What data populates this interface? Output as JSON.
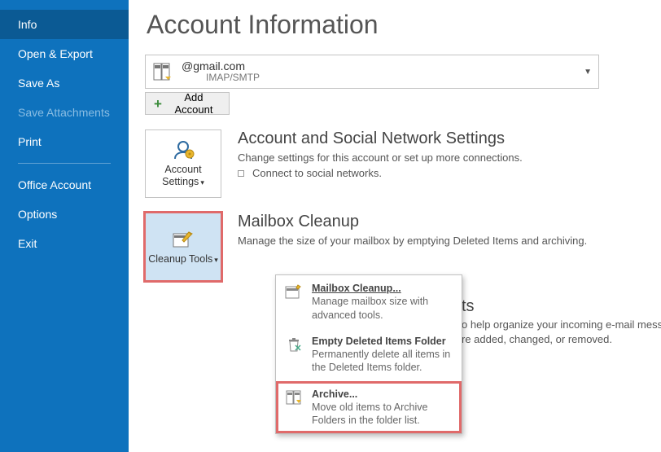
{
  "sidebar": {
    "items": [
      {
        "label": "Info",
        "state": "active"
      },
      {
        "label": "Open & Export",
        "state": "normal"
      },
      {
        "label": "Save As",
        "state": "normal"
      },
      {
        "label": "Save Attachments",
        "state": "disabled"
      },
      {
        "label": "Print",
        "state": "normal"
      }
    ],
    "items2": [
      {
        "label": "Office Account",
        "state": "normal"
      },
      {
        "label": "Options",
        "state": "normal"
      },
      {
        "label": "Exit",
        "state": "normal"
      }
    ]
  },
  "header": {
    "title": "Account Information"
  },
  "account": {
    "email_suffix": "@gmail.com",
    "protocol": "IMAP/SMTP"
  },
  "add_account": {
    "label": "Add Account"
  },
  "sections": {
    "social": {
      "tile_label": "Account Settings",
      "title": "Account and Social Network Settings",
      "desc": "Change settings for this account or set up more connections.",
      "bullet": "Connect to social networks."
    },
    "cleanup": {
      "tile_label": "Cleanup Tools",
      "title": "Mailbox Cleanup",
      "desc": "Manage the size of your mailbox by emptying Deleted Items and archiving."
    },
    "rules_peek": {
      "title_suffix": "ts",
      "line1": "o help organize your incoming e-mail messages, and receive",
      "line2": "re added, changed, or removed."
    }
  },
  "menu": {
    "items": [
      {
        "title": "Mailbox Cleanup...",
        "desc": "Manage mailbox size with advanced tools."
      },
      {
        "title": "Empty Deleted Items Folder",
        "desc": "Permanently delete all items in the Deleted Items folder."
      },
      {
        "title": "Archive...",
        "desc": "Move old items to Archive Folders in the folder list."
      }
    ]
  }
}
